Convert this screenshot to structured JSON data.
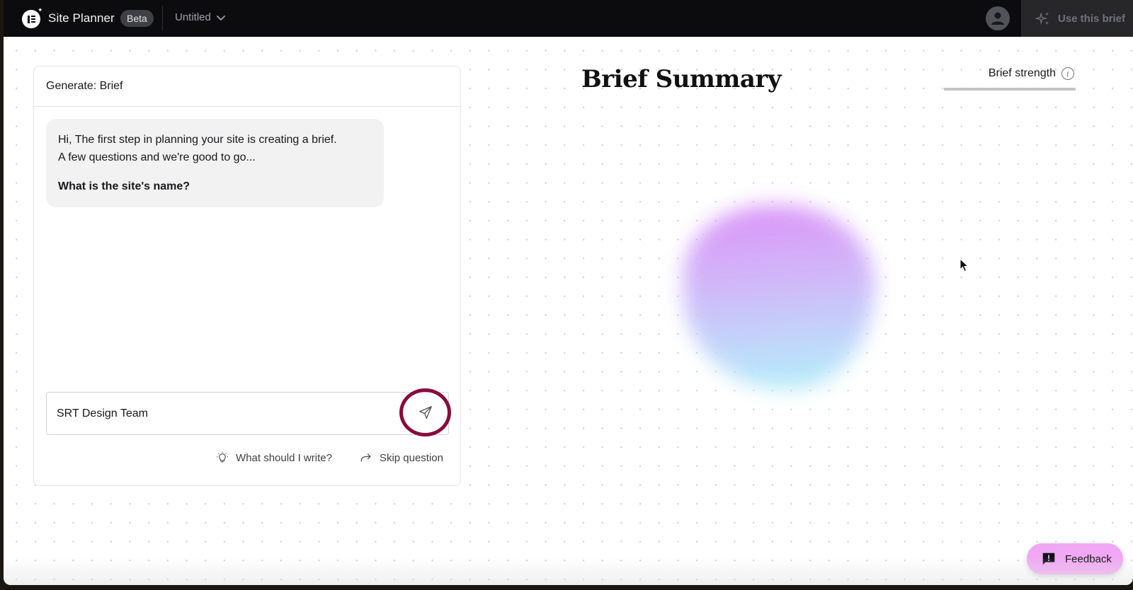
{
  "topbar": {
    "app_title": "Site Planner",
    "badge": "Beta",
    "document_name": "Untitled",
    "use_brief_label": "Use this brief"
  },
  "chat": {
    "header": "Generate: Brief",
    "message_line1": "Hi, The first step in planning your site is creating a brief.",
    "message_line2": "A few questions and we're good to go...",
    "question": "What is the site's name?",
    "input_value": "SRT Design Team",
    "input_placeholder": "",
    "actions": {
      "hint_label": "What should I write?",
      "skip_label": "Skip question"
    }
  },
  "summary": {
    "title": "Brief Summary",
    "strength_label": "Brief strength",
    "strength_percent": 0
  },
  "feedback": {
    "label": "Feedback"
  },
  "colors": {
    "accent_highlight": "#8a0a3c",
    "feedback_bg": "#f0a8f4",
    "topbar_bg": "#0c0c0e"
  }
}
